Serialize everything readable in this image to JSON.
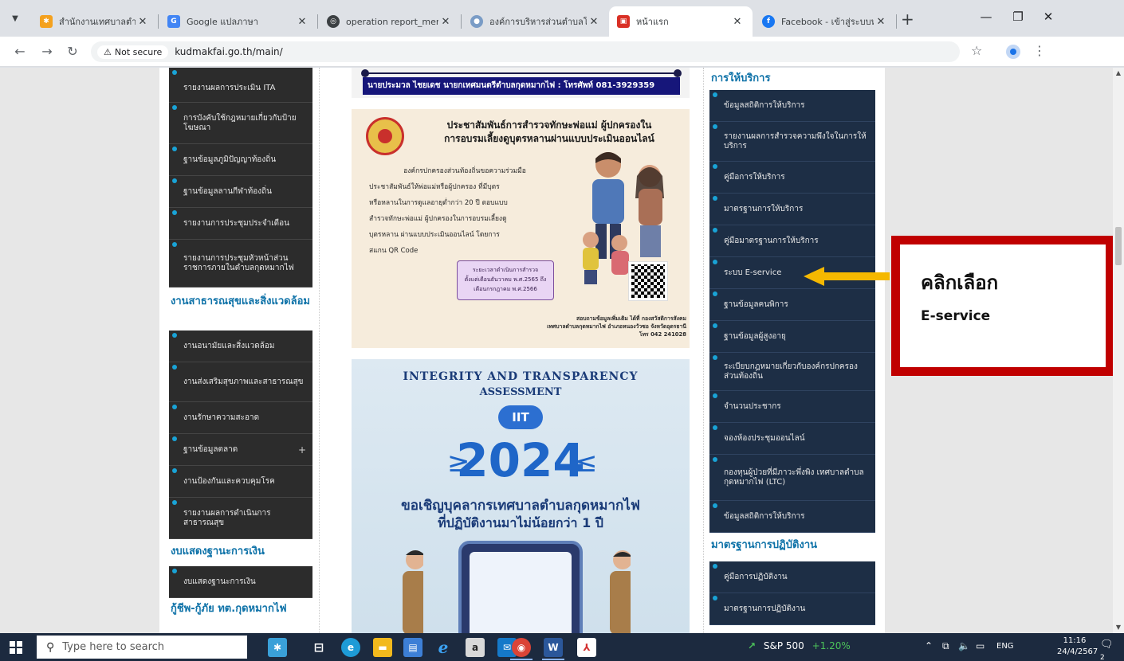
{
  "browser": {
    "tabs": [
      {
        "title": "สำนักงานเทศบาลตำบลกุดห",
        "favicon": "joomla-icon",
        "color": "#f4a11e"
      },
      {
        "title": "Google แปลภาษา",
        "favicon": "google-translate-icon",
        "color": "#4285f4"
      },
      {
        "title": "operation report_merg",
        "favicon": "globe-icon",
        "color": "#3c4043"
      },
      {
        "title": "องค์การบริหารส่วนตำบลโค",
        "favicon": "site-icon",
        "color": "#7a9cc6"
      },
      {
        "title": "หน้าแรก",
        "favicon": "site-icon",
        "color": "#d93025",
        "active": true
      },
      {
        "title": "Facebook - เข้าสู่ระบบหรือ",
        "favicon": "facebook-icon",
        "color": "#1877f2"
      }
    ],
    "new_tab_label": "+",
    "security_label": "Not secure",
    "url": "kudmakfai.go.th/main/"
  },
  "left_menu": {
    "group1": [
      "รายงานผลการประเมิน ITA",
      "การบังคับใช้กฎหมายเกี่ยวกับป้ายโฆษณา",
      "ฐานข้อมูลภูมิปัญญาท้องถิ่น",
      "ฐานข้อมูลลานกีฬาท้องถิ่น",
      "รายงานการประชุมประจำเดือน",
      "รายงานการประชุมหัวหน้าส่วนราชการภายในตำบลกุดหมากไฟ"
    ],
    "section2_title": "งานสาธารณสุขและสิ่งแวดล้อม",
    "group2": [
      "งานอนามัยและสิ่งแวดล้อม",
      "งานส่งเสริมสุขภาพและสาธารณสุข",
      "งานรักษาความสะอาด",
      "ฐานข้อมูลตลาด",
      "งานป้องกันและควบคุมโรค",
      "รายงานผลการดำเนินการสาธารณสุข"
    ],
    "expand_label": "+",
    "section3_title": "งบแสดงฐานะการเงิน",
    "group3": [
      "งบแสดงฐานะการเงิน"
    ],
    "section4_title": "กู้ชีพ-กู้ภัย ทต.กุดหมากไฟ"
  },
  "right_menu": {
    "section1_title": "การให้บริการ",
    "group1": [
      "ข้อมูลสถิติการให้บริการ",
      "รายงานผลการสำรวจความพึงใจในการให้บริการ",
      "คู่มือการให้บริการ",
      "มาตรฐานการให้บริการ",
      "คู่มือมาตรฐานการให้บริการ",
      "ระบบ E-service",
      "ฐานข้อมูลคนพิการ",
      "ฐานข้อมูลผู้สูงอายุ",
      "ระเบียบกฎหมายเกี่ยวกับองค์กรปกครองส่วนท้องถิ่น",
      "จำนวนประชากร",
      "จองห้องประชุมออนไลน์",
      "กองทุนผู้ป่วยที่มีภาวะพึ่งพิง เทศบาลตำบลกุดหมากไฟ (LTC)",
      "ข้อมูลสถิติการให้บริการ"
    ],
    "section2_title": "มาตรฐานการปฏิบัติงาน",
    "group2": [
      "คู่มือการปฏิบัติงาน",
      "มาตรฐานการปฏิบัติงาน"
    ]
  },
  "center": {
    "banner_text": "นายประมวล ไชยเดช นายกเทศมนตรีตำบลกุดหมากไฟ : โทรศัพท์ 081-3929359",
    "poster1": {
      "title_line1": "ประชาสัมพันธ์การสำรวจทักษะพ่อแม่ ผู้ปกครองใน",
      "title_line2": "การอบรมเลี้ยงดูบุตรหลานผ่านแบบประเมินออนไลน์",
      "body_lines": [
        "องค์กรปกครองส่วนท้องถิ่นขอความร่วมมือ",
        "ประชาสัมพันธ์ให้พ่อแม่หรือผู้ปกครอง ที่มีบุตร",
        "หรือหลานในการดูแลอายุต่ำกว่า 20 ปี ตอบแบบ",
        "สำรวจทักษะพ่อแม่ ผู้ปกครองในการอบรมเลี้ยงดู",
        "บุตรหลาน ผ่านแบบประเมินออนไลน์ โดยการ",
        "สแกน QR Code"
      ],
      "box_lines": [
        "ระยะเวลาดำเนินการสำรวจ",
        "ตั้งแต่เดือนธันวาคม พ.ศ.2565 ถึง",
        "เดือนกรกฎาคม พ.ศ.2566"
      ],
      "footer_lines": [
        "สอบถามข้อมูลเพิ่มเติม ได้ที่ กองสวัสดิการสังคม",
        "เทศบาลตำบลกุดหมากไฟ อำเภอหนองวัวซอ จังหวัดอุดรธานี",
        "โทร 042 241028"
      ]
    },
    "poster2": {
      "arc_line1": "INTEGRITY AND TRANSPARENCY",
      "arc_line2": "ASSESSMENT",
      "pill": "IIT",
      "year": "2024",
      "line1": "ขอเชิญบุคลากรเทศบาลตำบลกุดหมากไฟ",
      "line2": "ที่ปฏิบัติงานมาไม่น้อยกว่า 1 ปี"
    }
  },
  "annotation": {
    "line1": "คลิกเลือก",
    "line2": "E-service",
    "border_color": "#c00000",
    "arrow_color": "#f5b800"
  },
  "taskbar": {
    "search_placeholder": "Type here to search",
    "stock_name": "S&P 500",
    "stock_change": "+1.20%",
    "language": "ENG",
    "time": "11:16",
    "date": "24/4/2567",
    "notification_count": "2",
    "apps": [
      "widgets-icon",
      "task-view-icon",
      "edge-icon",
      "file-explorer-icon",
      "store-icon",
      "internet-explorer-icon",
      "amazon-icon",
      "mail-icon",
      "chrome-icon",
      "word-icon",
      "acrobat-icon"
    ]
  }
}
